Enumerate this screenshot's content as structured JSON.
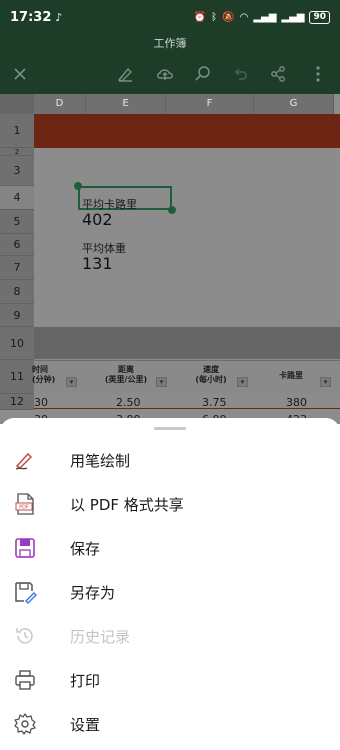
{
  "status": {
    "time": "17:32",
    "battery": "90"
  },
  "title": "工作簿",
  "columns": [
    "D",
    "E",
    "F",
    "G"
  ],
  "rows": [
    "1",
    "2",
    "3",
    "4",
    "5",
    "6",
    "7",
    "8",
    "9",
    "10",
    "11",
    "12"
  ],
  "kpi": {
    "calories_label": "平均卡路里",
    "calories_value": "402",
    "weight_label": "平均体重",
    "weight_value": "131"
  },
  "table_header": {
    "time": "时间\n(分钟)",
    "distance": "距离\n(英里/公里)",
    "speed": "速度\n(每小时)",
    "calories": "卡路里"
  },
  "table_rows": [
    {
      "time": "30",
      "distance": "2.50",
      "speed": "3.75",
      "calories": "380"
    },
    {
      "time": "30",
      "distance": "3.00",
      "speed": "6.00",
      "calories": "423"
    }
  ],
  "menu": [
    {
      "label": "用笔绘制",
      "icon": "pen-draw-icon",
      "enabled": true
    },
    {
      "label": "以 PDF 格式共享",
      "icon": "pdf-icon",
      "enabled": true
    },
    {
      "label": "保存",
      "icon": "save-icon",
      "enabled": true
    },
    {
      "label": "另存为",
      "icon": "save-as-icon",
      "enabled": true
    },
    {
      "label": "历史记录",
      "icon": "history-icon",
      "enabled": false
    },
    {
      "label": "打印",
      "icon": "print-icon",
      "enabled": true
    },
    {
      "label": "设置",
      "icon": "settings-icon",
      "enabled": true
    }
  ],
  "colors": {
    "excel_green": "#1e3d28",
    "accent_red": "#c0504d",
    "save_purple": "#9b3cc0"
  }
}
